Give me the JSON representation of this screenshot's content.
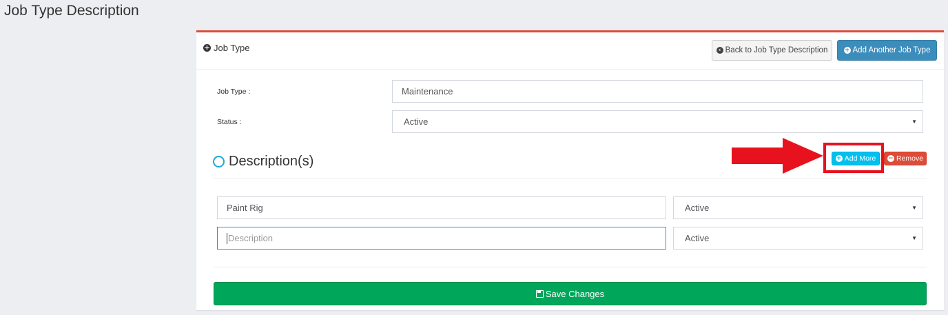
{
  "page": {
    "title": "Job Type Description"
  },
  "panel": {
    "heading": "Job Type",
    "back_button": "Back to Job Type Description",
    "add_job_button": "Add Another Job Type"
  },
  "form": {
    "job_type_label": "Job Type :",
    "job_type_value": "Maintenance",
    "status_label": "Status :",
    "status_value": "Active"
  },
  "descriptions": {
    "heading": "Description(s)",
    "add_more_button": "Add More",
    "remove_button": "Remove",
    "rows": [
      {
        "value": "Paint Rig",
        "placeholder": "",
        "status": "Active"
      },
      {
        "value": "",
        "placeholder": "Description",
        "status": "Active"
      }
    ]
  },
  "save_button": "Save Changes",
  "colors": {
    "primary": "#3c8dbc",
    "info": "#00c0ef",
    "danger": "#dd4b39",
    "success": "#00a65a",
    "highlight": "#e8121f"
  }
}
